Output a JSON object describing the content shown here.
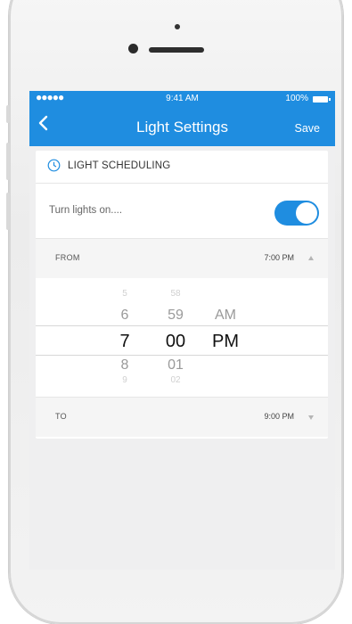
{
  "status_bar": {
    "signal": "●●●●●",
    "time": "9:41 AM",
    "battery": "100%"
  },
  "nav": {
    "title": "Light Settings",
    "save_label": "Save"
  },
  "section": {
    "title": "LIGHT SCHEDULING",
    "icon": "clock-icon"
  },
  "lights_row": {
    "label": "Turn lights on....",
    "toggle_on": true
  },
  "from": {
    "label": "FROM",
    "time": "7:00 PM"
  },
  "picker": {
    "hours": [
      "5",
      "6",
      "7",
      "8",
      "9"
    ],
    "minutes": [
      "58",
      "59",
      "00",
      "01",
      "02"
    ],
    "period": [
      "AM",
      "PM"
    ]
  },
  "to": {
    "label": "TO",
    "time": "9:00 PM"
  },
  "colors": {
    "accent": "#1f8de0",
    "background": "#efeff0"
  }
}
